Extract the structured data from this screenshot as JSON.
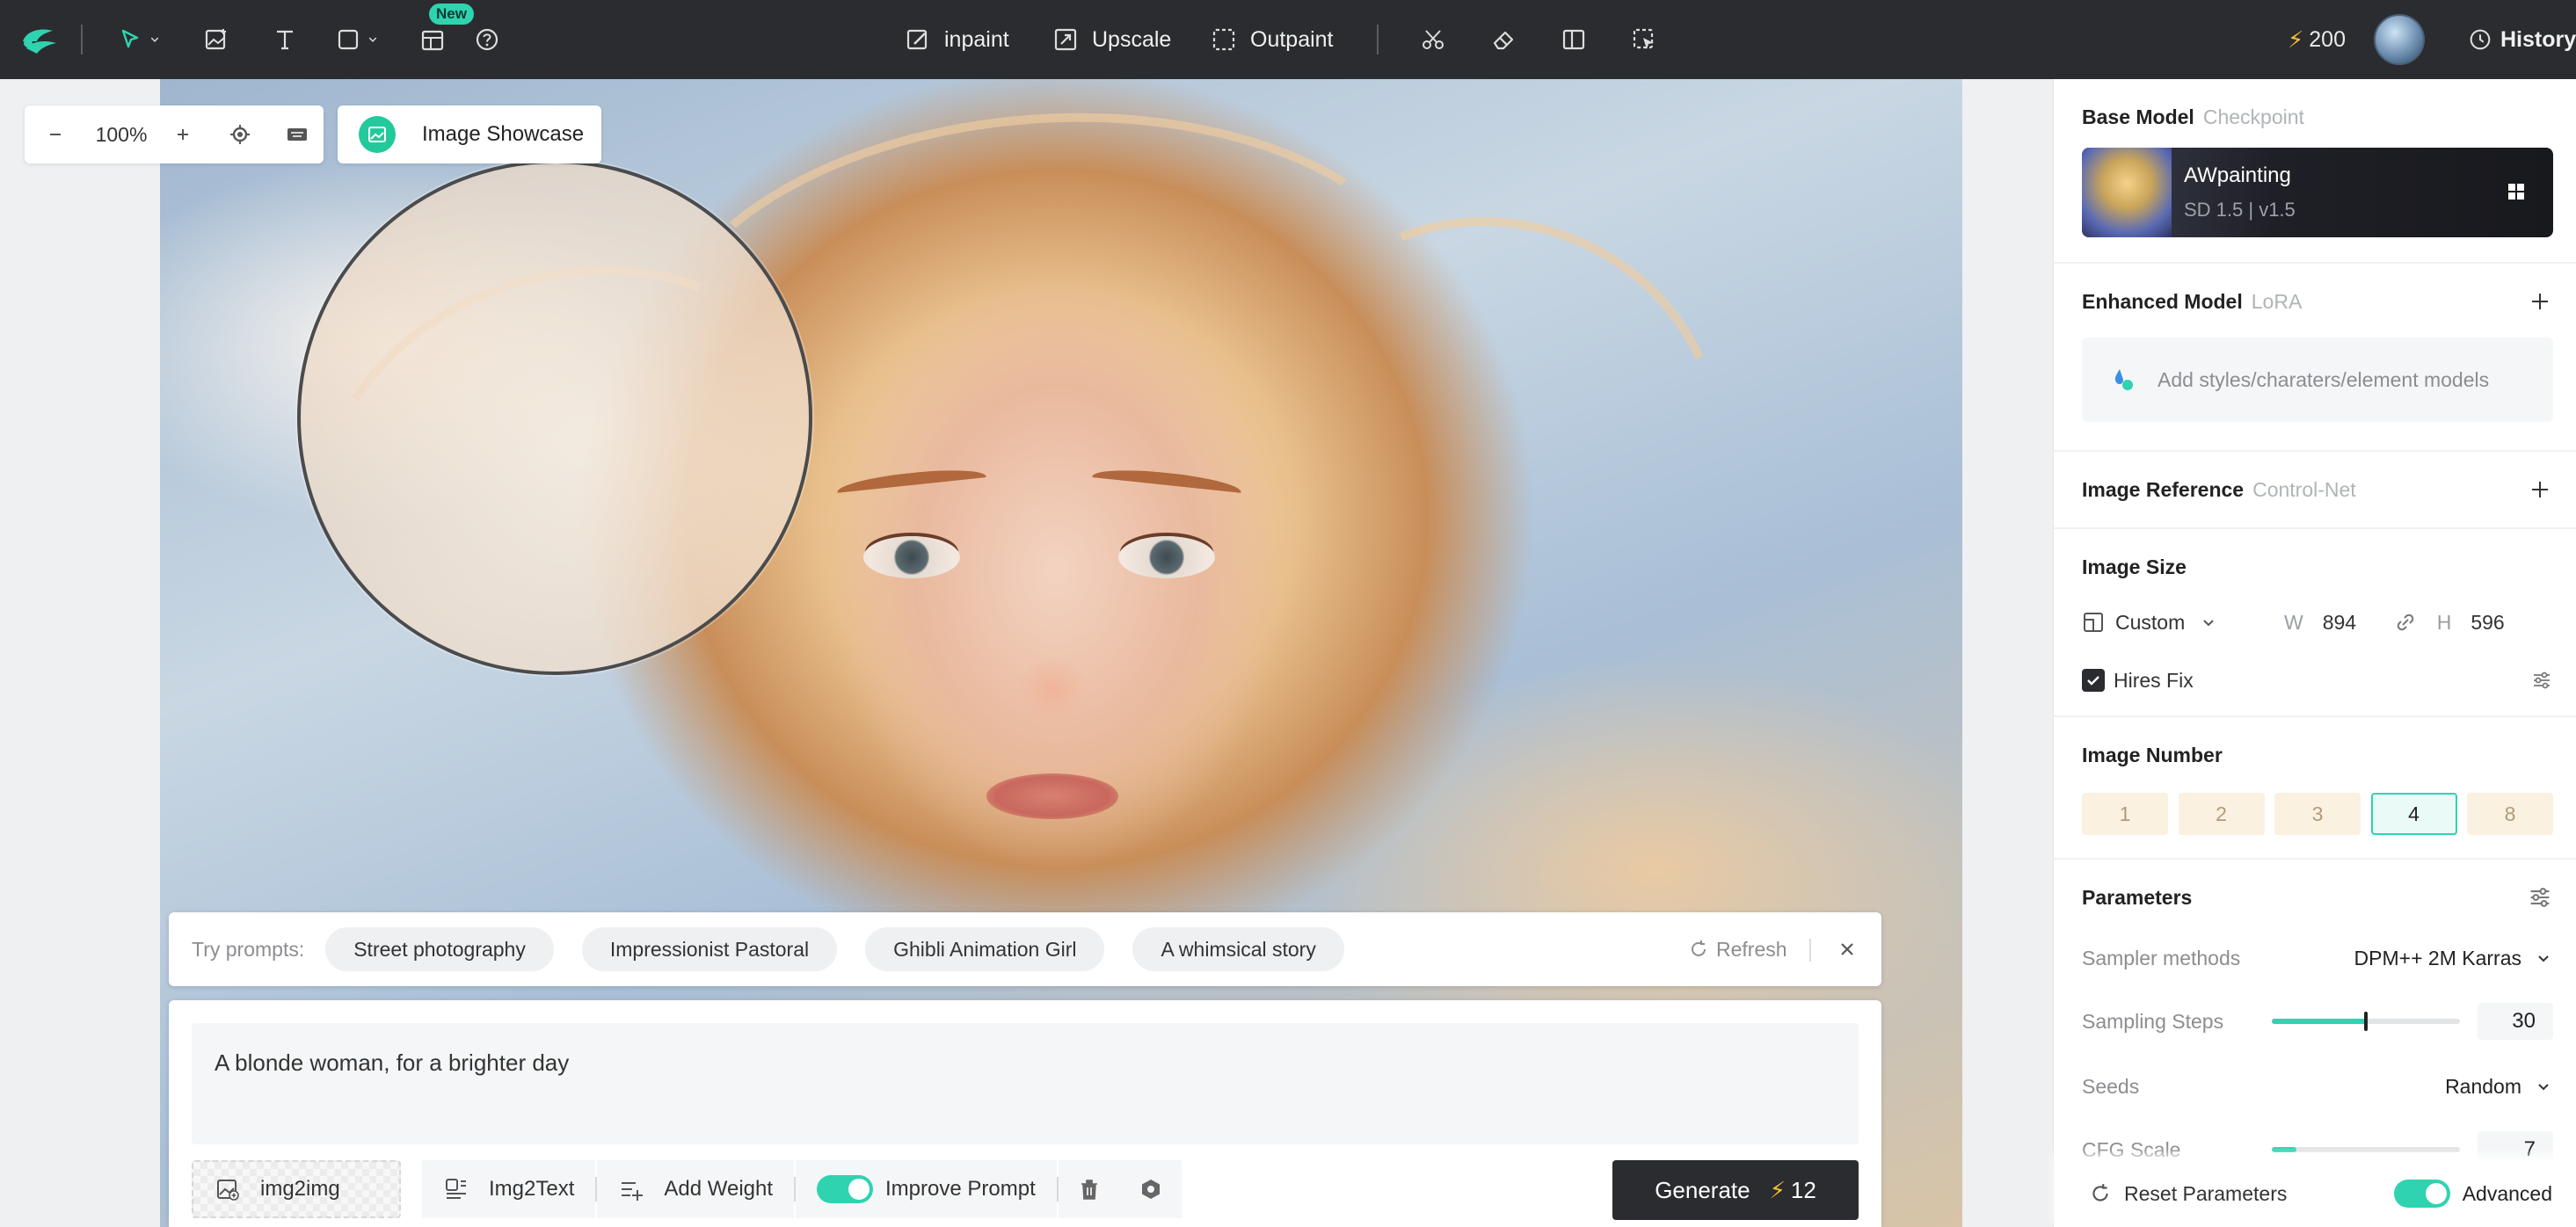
{
  "toolbar": {
    "new_badge": "New",
    "inpaint": "inpaint",
    "upscale": "Upscale",
    "outpaint": "Outpaint",
    "credits": "200",
    "history": "History"
  },
  "canvas": {
    "zoom": "100%",
    "showcase_label": "Image Showcase"
  },
  "try_prompts": {
    "label": "Try prompts:",
    "chips": [
      "Street photography",
      "Impressionist Pastoral",
      "Ghibli Animation Girl",
      "A whimsical story"
    ],
    "refresh": "Refresh"
  },
  "prompt": {
    "text": "A blonde woman, for a brighter day",
    "img2img": "img2img",
    "img2text": "Img2Text",
    "add_weight": "Add Weight",
    "improve_prompt": "Improve Prompt",
    "improve_prompt_on": true,
    "generate": "Generate",
    "generate_cost": "12"
  },
  "panel": {
    "base_model": {
      "title": "Base Model",
      "subtitle": "Checkpoint",
      "name": "AWpainting",
      "meta": "SD 1.5  |  v1.5"
    },
    "enhanced_model": {
      "title": "Enhanced Model",
      "subtitle": "LoRA",
      "placeholder": "Add styles/charaters/element models"
    },
    "image_reference": {
      "title": "Image Reference",
      "subtitle": "Control-Net"
    },
    "image_size": {
      "title": "Image Size",
      "preset": "Custom",
      "w_label": "W",
      "w": "894",
      "h_label": "H",
      "h": "596",
      "hires_fix": "Hires Fix",
      "hires_fix_checked": true
    },
    "image_number": {
      "title": "Image Number",
      "options": [
        "1",
        "2",
        "3",
        "4",
        "8"
      ],
      "selected": "4"
    },
    "parameters": {
      "title": "Parameters",
      "sampler_label": "Sampler methods",
      "sampler_value": "DPM++ 2M Karras",
      "steps_label": "Sampling Steps",
      "steps_value": "30",
      "steps_fraction": 0.5,
      "seeds_label": "Seeds",
      "seeds_value": "Random",
      "cfg_label": "CFG Scale",
      "cfg_value": "7"
    },
    "footer": {
      "reset": "Reset Parameters",
      "advanced": "Advanced",
      "advanced_on": true
    }
  },
  "colors": {
    "accent": "#2fd3b0",
    "topbar": "#2b2c2f",
    "generate_bg": "#2b2c2f",
    "bolt": "#f7c232"
  }
}
